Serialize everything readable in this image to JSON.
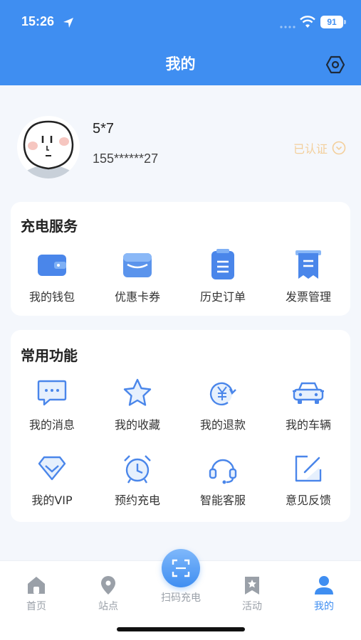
{
  "status_bar": {
    "time": "15:26",
    "battery": "91"
  },
  "header": {
    "title": "我的"
  },
  "profile": {
    "name": "5*7",
    "phone": "155******27",
    "verified_label": "已认证"
  },
  "services": {
    "title": "充电服务",
    "items": [
      {
        "label": "我的钱包",
        "icon": "wallet-icon"
      },
      {
        "label": "优惠卡券",
        "icon": "coupon-icon"
      },
      {
        "label": "历史订单",
        "icon": "order-history-icon"
      },
      {
        "label": "发票管理",
        "icon": "invoice-icon"
      }
    ]
  },
  "common": {
    "title": "常用功能",
    "items": [
      {
        "label": "我的消息",
        "icon": "message-icon"
      },
      {
        "label": "我的收藏",
        "icon": "star-icon"
      },
      {
        "label": "我的退款",
        "icon": "refund-icon"
      },
      {
        "label": "我的车辆",
        "icon": "car-icon"
      },
      {
        "label": "我的VIP",
        "icon": "vip-icon"
      },
      {
        "label": "预约充电",
        "icon": "alarm-clock-icon"
      },
      {
        "label": "智能客服",
        "icon": "headset-icon"
      },
      {
        "label": "意见反馈",
        "icon": "feedback-icon"
      }
    ]
  },
  "tabbar": {
    "items": [
      {
        "label": "首页",
        "icon": "home-icon"
      },
      {
        "label": "站点",
        "icon": "location-pin-icon"
      },
      {
        "label": "扫码充电",
        "icon": "scan-icon"
      },
      {
        "label": "活动",
        "icon": "bookmark-star-icon"
      },
      {
        "label": "我的",
        "icon": "user-icon",
        "active": true
      }
    ]
  },
  "colors": {
    "primary": "#3f8ef1",
    "verified": "#f3cf9b",
    "background": "#f4f7fc"
  }
}
